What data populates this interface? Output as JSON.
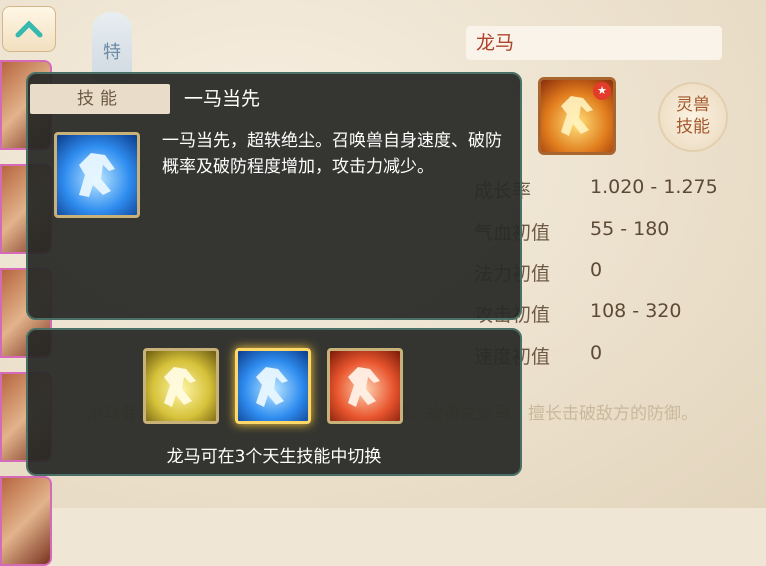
{
  "colors": {
    "accent": "#b0432b",
    "tooltip_bg": "#282926",
    "selected_glow": "#ffce3d"
  },
  "top_tab": {
    "label": "特"
  },
  "pet": {
    "name": "龙马"
  },
  "spirit_button": {
    "line1": "灵兽",
    "line2": "技能"
  },
  "stats": [
    {
      "label": "成长率",
      "value": "1.020 - 1.275"
    },
    {
      "label": "气血初值",
      "value": "55 - 180"
    },
    {
      "label": "法力初值",
      "value": "0"
    },
    {
      "label": "攻击初值",
      "value": "108 - 320"
    },
    {
      "label": "速度初值",
      "value": "0"
    }
  ],
  "description": "龙马者，天地之精，其为形也，马身而龙鳞，故谓之龙马。擅长击破敌方的防御。",
  "tooltip": {
    "tag": "技能",
    "skill_name": "一马当先",
    "skill_text": "一马当先，超轶绝尘。召唤兽自身速度、破防概率及破防程度增加，攻击力减少。",
    "switch_text": "龙马可在3个天生技能中切换",
    "options": [
      {
        "icon": "golden-horse-icon",
        "color": "#d6c23a"
      },
      {
        "icon": "blue-horse-icon",
        "color": "#2f8df0",
        "selected": true
      },
      {
        "icon": "red-horse-icon",
        "color": "#e8552e"
      }
    ]
  }
}
